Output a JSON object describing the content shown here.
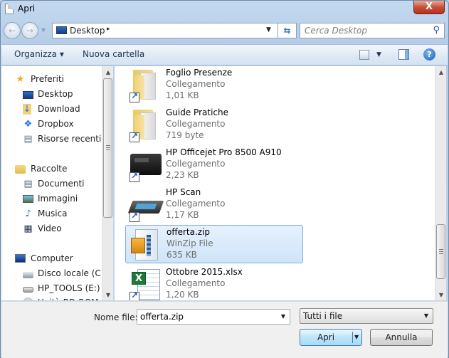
{
  "window": {
    "title": "Apri",
    "close_label": "X"
  },
  "navbar": {
    "back_icon": "back-arrow-icon",
    "forward_icon": "forward-arrow-icon",
    "address": {
      "location": "Desktop",
      "separator": "▸"
    },
    "search": {
      "placeholder": "Cerca Desktop",
      "value": ""
    }
  },
  "toolbar": {
    "organize_label": "Organizza ▾",
    "new_folder_label": "Nuova cartella",
    "help_label": "?"
  },
  "sidebar": {
    "groups": [
      {
        "label": "Preferiti",
        "icon": "star-icon",
        "items": [
          {
            "label": "Desktop",
            "icon": "desktop-icon"
          },
          {
            "label": "Download",
            "icon": "download-folder-icon"
          },
          {
            "label": "Dropbox",
            "icon": "dropbox-icon"
          },
          {
            "label": "Risorse recenti",
            "icon": "recent-places-icon"
          }
        ]
      },
      {
        "label": "Raccolte",
        "icon": "libraries-icon",
        "items": [
          {
            "label": "Documenti",
            "icon": "documents-icon"
          },
          {
            "label": "Immagini",
            "icon": "pictures-icon"
          },
          {
            "label": "Musica",
            "icon": "music-icon"
          },
          {
            "label": "Video",
            "icon": "video-icon"
          }
        ]
      },
      {
        "label": "Computer",
        "icon": "computer-icon",
        "items": [
          {
            "label": "Disco locale (C:)",
            "icon": "local-disk-icon"
          },
          {
            "label": "HP_TOOLS (E:)",
            "icon": "drive-icon"
          },
          {
            "label": "Unità BD-ROM (",
            "icon": "optical-drive-icon"
          }
        ]
      }
    ]
  },
  "files": [
    {
      "name": "Foglio Presenze",
      "type": "Collegamento",
      "size": "1,01 KB",
      "icon": "folder-shortcut-icon",
      "selected": false
    },
    {
      "name": "Guide Pratiche",
      "type": "Collegamento",
      "size": "719 byte",
      "icon": "folder-shortcut-icon",
      "selected": false
    },
    {
      "name": "HP Officejet Pro 8500 A910",
      "type": "Collegamento",
      "size": "2,23 KB",
      "icon": "printer-icon",
      "selected": false
    },
    {
      "name": "HP Scan",
      "type": "Collegamento",
      "size": "1,17 KB",
      "icon": "scanner-icon",
      "selected": false
    },
    {
      "name": "offerta.zip",
      "type": "WinZip File",
      "size": "635 KB",
      "icon": "zip-file-icon",
      "selected": true
    },
    {
      "name": "Ottobre 2015.xlsx",
      "type": "Collegamento",
      "size": "1,20 KB",
      "icon": "excel-file-icon",
      "selected": false
    }
  ],
  "footer": {
    "filename_label": "Nome file:",
    "filename_value": "offerta.zip",
    "filetype_value": "Tutti i file",
    "open_label": "Apri",
    "cancel_label": "Annulla"
  },
  "colors": {
    "selection_bg": "#cfe4fa",
    "selection_border": "#84acdd",
    "close_button": "#c7503a"
  }
}
